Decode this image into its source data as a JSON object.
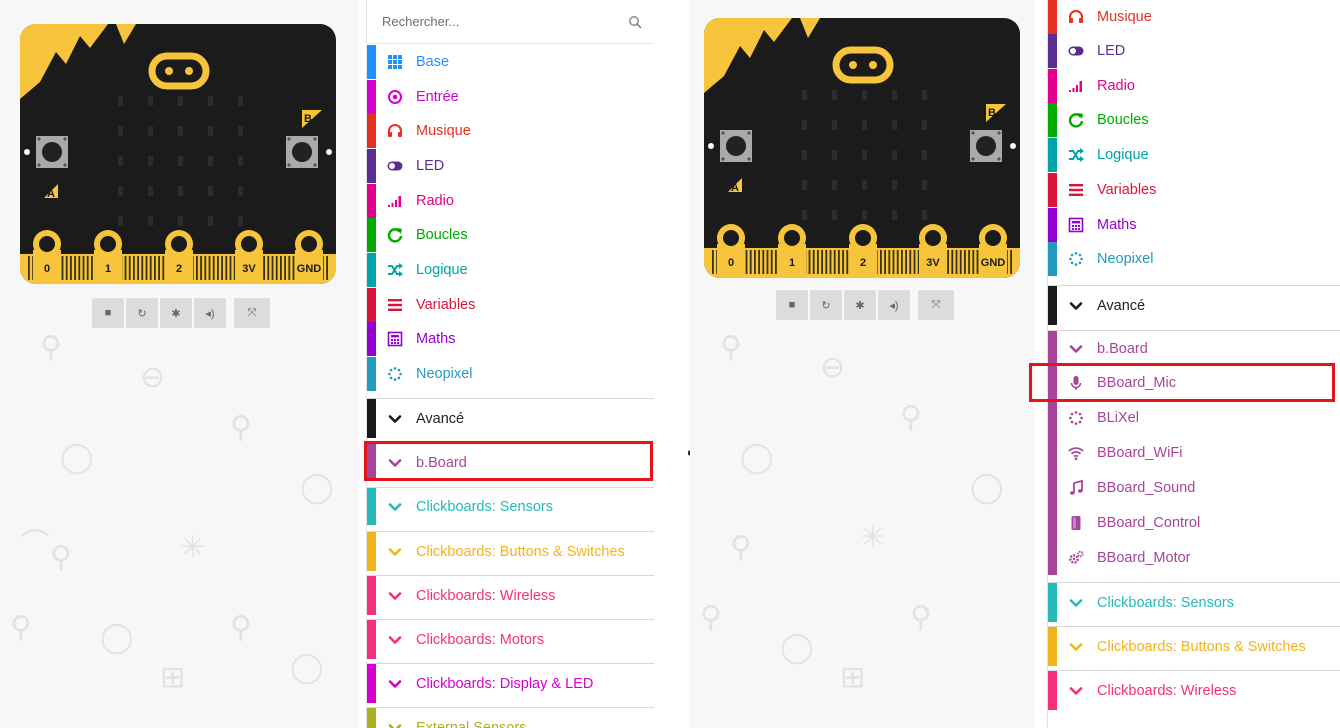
{
  "simulator": {
    "pin_labels": [
      "0",
      "1",
      "2",
      "3V",
      "GND"
    ],
    "button_a": "A",
    "button_b": "B",
    "controls": [
      "stop-icon",
      "restart-icon",
      "debug-icon",
      "audio-icon",
      "fullscreen-icon"
    ]
  },
  "left_toolbox": {
    "search_placeholder": "Rechercher...",
    "items": [
      {
        "label": "Base",
        "color": "#1e90ff",
        "icon": "grid-icon"
      },
      {
        "label": "Entrée",
        "color": "#d400d4",
        "icon": "target-icon"
      },
      {
        "label": "Musique",
        "color": "#e63022",
        "icon": "headphones-icon"
      },
      {
        "label": "LED",
        "color": "#5c2d91",
        "icon": "toggle-icon"
      },
      {
        "label": "Radio",
        "color": "#e3008c",
        "icon": "signal-icon"
      },
      {
        "label": "Boucles",
        "color": "#00aa00",
        "icon": "refresh-icon"
      },
      {
        "label": "Logique",
        "color": "#00a4a6",
        "icon": "shuffle-icon"
      },
      {
        "label": "Variables",
        "color": "#dc143c",
        "icon": "list-icon"
      },
      {
        "label": "Maths",
        "color": "#9400d3",
        "icon": "calculator-icon"
      },
      {
        "label": "Neopixel",
        "color": "#2699bf",
        "icon": "dotted-circle-icon"
      },
      {
        "label": "Avancé",
        "color": "#1a1a1a",
        "icon": "chevron-down-icon"
      },
      {
        "label": "b.Board",
        "color": "#a7459b",
        "icon": "chevron-down-icon"
      },
      {
        "label": "Clickboards: Sensors",
        "color": "#25b9b9",
        "icon": "chevron-down-icon"
      },
      {
        "label": "Clickboards: Buttons & Switches",
        "color": "#f3b31b",
        "icon": "chevron-down-icon"
      },
      {
        "label": "Clickboards: Wireless",
        "color": "#f4307a",
        "icon": "chevron-down-icon"
      },
      {
        "label": "Clickboards: Motors",
        "color": "#f4307a",
        "icon": "chevron-down-icon"
      },
      {
        "label": "Clickboards: Display & LED",
        "color": "#d400d4",
        "icon": "chevron-down-icon"
      },
      {
        "label": "External Sensors",
        "color": "#aab020",
        "icon": "chevron-down-icon"
      }
    ]
  },
  "right_toolbox": {
    "items": [
      {
        "label": "Musique",
        "color": "#e63022",
        "icon": "headphones-icon"
      },
      {
        "label": "LED",
        "color": "#5c2d91",
        "icon": "toggle-icon"
      },
      {
        "label": "Radio",
        "color": "#e3008c",
        "icon": "signal-icon"
      },
      {
        "label": "Boucles",
        "color": "#00aa00",
        "icon": "refresh-icon"
      },
      {
        "label": "Logique",
        "color": "#00a4a6",
        "icon": "shuffle-icon"
      },
      {
        "label": "Variables",
        "color": "#dc143c",
        "icon": "list-icon"
      },
      {
        "label": "Maths",
        "color": "#9400d3",
        "icon": "calculator-icon"
      },
      {
        "label": "Neopixel",
        "color": "#2699bf",
        "icon": "dotted-circle-icon"
      },
      {
        "label": "Avancé",
        "color": "#1a1a1a",
        "icon": "chevron-down-icon"
      },
      {
        "label": "b.Board",
        "color": "#a7459b",
        "icon": "chevron-down-icon"
      },
      {
        "label": "BBoard_Mic",
        "color": "#a7459b",
        "icon": "microphone-icon"
      },
      {
        "label": "BLiXel",
        "color": "#a7459b",
        "icon": "dotted-circle-icon"
      },
      {
        "label": "BBoard_WiFi",
        "color": "#a7459b",
        "icon": "wifi-icon"
      },
      {
        "label": "BBoard_Sound",
        "color": "#a7459b",
        "icon": "music-note-icon"
      },
      {
        "label": "BBoard_Control",
        "color": "#a7459b",
        "icon": "device-icon"
      },
      {
        "label": "BBoard_Motor",
        "color": "#a7459b",
        "icon": "gears-icon"
      },
      {
        "label": "Clickboards: Sensors",
        "color": "#25b9b9",
        "icon": "chevron-down-icon"
      },
      {
        "label": "Clickboards: Buttons & Switches",
        "color": "#f3b31b",
        "icon": "chevron-down-icon"
      },
      {
        "label": "Clickboards: Wireless",
        "color": "#f4307a",
        "icon": "chevron-down-icon"
      }
    ]
  },
  "highlight_color": "#e4141b",
  "arrow_color": "#2c1f47",
  "board_color": "#1b1b1b",
  "board_accent": "#f6c53b"
}
